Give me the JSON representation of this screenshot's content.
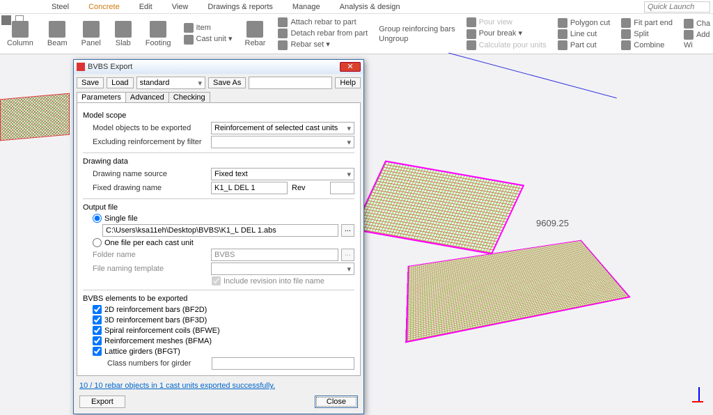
{
  "menu": [
    "Steel",
    "Concrete",
    "Edit",
    "View",
    "Drawings & reports",
    "Manage",
    "Analysis & design"
  ],
  "active_menu": "Concrete",
  "quick_launch_placeholder": "Quick Launch",
  "ribbon": {
    "big": [
      "Column",
      "Beam",
      "Panel",
      "Slab",
      "Footing"
    ],
    "cast": {
      "item": "Item",
      "cast_unit": "Cast unit"
    },
    "rebar_label": "Rebar",
    "rebar_group": [
      "Attach rebar to part",
      "Detach rebar from part",
      "Rebar set"
    ],
    "group_col": [
      "Group reinforcing bars",
      "Ungroup"
    ],
    "pour_col": [
      "Pour view",
      "Pour break",
      "Calculate pour units"
    ],
    "cut_col": [
      "Polygon cut",
      "Line cut",
      "Part cut"
    ],
    "fit_col": [
      "Fit part end",
      "Split",
      "Combine"
    ],
    "extra": [
      "Cha",
      "Add",
      "Wi"
    ]
  },
  "viewport": {
    "dim_label": "9609.25"
  },
  "dialog": {
    "title": "BVBS Export",
    "save": "Save",
    "load": "Load",
    "save_as": "Save As",
    "help": "Help",
    "preset": "standard",
    "tabs": [
      "Parameters",
      "Advanced",
      "Checking"
    ],
    "active_tab": "Parameters",
    "model_scope": "Model scope",
    "model_objects_label": "Model objects to be exported",
    "model_objects_value": "Reinforcement of selected cast units",
    "exclude_label": "Excluding reinforcement by filter",
    "drawing_data": "Drawing data",
    "drawing_src_label": "Drawing name source",
    "drawing_src_value": "Fixed text",
    "fixed_name_label": "Fixed drawing name",
    "fixed_name_value": "K1_L DEL 1",
    "rev_label": "Rev",
    "output_file": "Output file",
    "single_file": "Single file",
    "single_path": "C:\\Users\\ksa11eh\\Desktop\\BVBS\\K1_L DEL 1.abs",
    "one_per": "One file per each cast unit",
    "folder_label": "Folder name",
    "folder_value": "BVBS",
    "naming_label": "File naming template",
    "include_rev": "Include revision into file name",
    "elements_title": "BVBS elements to be exported",
    "elem1": "2D reinforcement bars (BF2D)",
    "elem2": "3D reinforcement bars (BF3D)",
    "elem3": "Spiral reinforcement coils (BFWE)",
    "elem4": "Reinforcement meshes (BFMA)",
    "elem5": "Lattice girders (BFGT)",
    "class_numbers": "Class numbers for girder",
    "status": "10 / 10 rebar objects in 1 cast units exported successfully.",
    "export": "Export",
    "close": "Close"
  }
}
